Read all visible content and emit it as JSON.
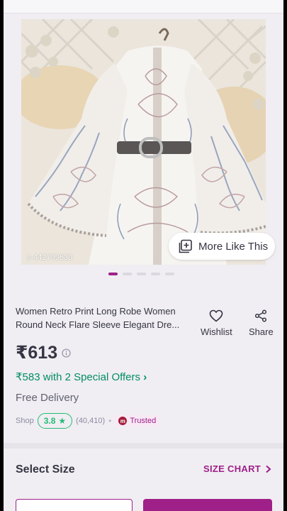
{
  "product": {
    "image_code": "s-442799630",
    "more_like_label": "More Like This",
    "carousel": {
      "total": 5,
      "active_index": 0
    },
    "title_line1": "Women Retro Print Long Robe Women",
    "title_line2": "Round Neck Flare Sleeve Elegant Dre...",
    "wishlist_label": "Wishlist",
    "share_label": "Share",
    "price": "₹613",
    "offers_text": "₹583 with 2 Special Offers",
    "delivery_text": "Free Delivery",
    "shop_label": "Shop",
    "rating_value": "3.8",
    "rating_count": "(40,410)",
    "trusted_label": "Trusted"
  },
  "size": {
    "title": "Select Size",
    "chart_label": "SIZE CHART"
  },
  "colors": {
    "accent": "#9f2089",
    "offer_green": "#038d63",
    "rating_green": "#23bb75"
  }
}
